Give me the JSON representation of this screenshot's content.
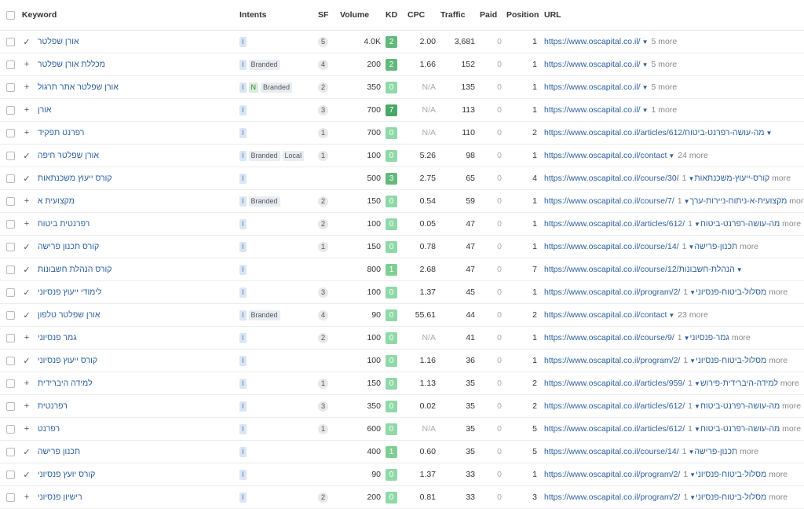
{
  "header": {
    "keyword": "Keyword",
    "intents": "Intents",
    "sf": "SF",
    "volume": "Volume",
    "kd": "KD",
    "cpc": "CPC",
    "traffic": "Traffic",
    "paid": "Paid",
    "position": "Position",
    "url": "URL"
  },
  "kd_colors": {
    "0": "#8fd9a8",
    "1": "#7fcf95",
    "2": "#62b97b",
    "3": "#62b97b",
    "7": "#4aa866"
  },
  "rows": [
    {
      "mark": "✓",
      "keyword": "אורן שפלטר",
      "intents": [
        "I"
      ],
      "sf": "5",
      "volume": "4.0K",
      "kd": "2",
      "cpc": "2.00",
      "traffic": "3,681",
      "paid": "0",
      "position": "1",
      "url": "https://www.oscapital.co.il/",
      "more": "5 more"
    },
    {
      "mark": "+",
      "keyword": "מכללת אורן שפלטר",
      "intents": [
        "I",
        "Branded"
      ],
      "sf": "4",
      "volume": "200",
      "kd": "2",
      "cpc": "1.66",
      "traffic": "152",
      "paid": "0",
      "position": "1",
      "url": "https://www.oscapital.co.il/",
      "more": "5 more"
    },
    {
      "mark": "+",
      "keyword": "אורן שפלטר אתר תרגול",
      "intents": [
        "I",
        "N",
        "Branded"
      ],
      "sf": "2",
      "volume": "350",
      "kd": "0",
      "cpc": "N/A",
      "traffic": "135",
      "paid": "0",
      "position": "1",
      "url": "https://www.oscapital.co.il/",
      "more": "5 more"
    },
    {
      "mark": "+",
      "keyword": "אורן",
      "intents": [
        "I"
      ],
      "sf": "3",
      "volume": "700",
      "kd": "7",
      "cpc": "N/A",
      "traffic": "113",
      "paid": "0",
      "position": "1",
      "url": "https://www.oscapital.co.il/",
      "more": "1 more"
    },
    {
      "mark": "+",
      "keyword": "רפרנט תפקיד",
      "intents": [
        "I"
      ],
      "sf": "1",
      "volume": "700",
      "kd": "0",
      "cpc": "N/A",
      "traffic": "110",
      "paid": "0",
      "position": "2",
      "url": "https://www.oscapital.co.il/articles/612/מה-עושה-רפרנט-ביטוח",
      "more": ""
    },
    {
      "mark": "✓",
      "keyword": "אורן שפלטר חיפה",
      "intents": [
        "I",
        "Branded",
        "Local"
      ],
      "sf": "1",
      "volume": "100",
      "kd": "0",
      "cpc": "5.26",
      "traffic": "98",
      "paid": "0",
      "position": "1",
      "url": "https://www.oscapital.co.il/contact",
      "more": "24 more"
    },
    {
      "mark": "✓",
      "keyword": "קורס ייעוץ משכנתאות",
      "intents": [
        "I"
      ],
      "sf": "",
      "volume": "500",
      "kd": "3",
      "cpc": "2.75",
      "traffic": "65",
      "paid": "0",
      "position": "4",
      "url": "https://www.oscapital.co.il/course/30/קורס-ייעוץ-משכנתאות",
      "more": "1 more"
    },
    {
      "mark": "+",
      "keyword": "מקצועית א",
      "intents": [
        "I",
        "Branded"
      ],
      "sf": "2",
      "volume": "150",
      "kd": "0",
      "cpc": "0.54",
      "traffic": "59",
      "paid": "0",
      "position": "1",
      "url": "https://www.oscapital.co.il/course/7/מקצועית-א-ניתוח-ניירות-ערך",
      "more": "1 more"
    },
    {
      "mark": "+",
      "keyword": "רפרנטית ביטוח",
      "intents": [
        "I"
      ],
      "sf": "2",
      "volume": "100",
      "kd": "0",
      "cpc": "0.05",
      "traffic": "47",
      "paid": "0",
      "position": "1",
      "url": "https://www.oscapital.co.il/articles/612/מה-עושה-רפרנט-ביטוח",
      "more": "1 more"
    },
    {
      "mark": "✓",
      "keyword": "קורס תכנון פרישה",
      "intents": [
        "I"
      ],
      "sf": "1",
      "volume": "150",
      "kd": "0",
      "cpc": "0.78",
      "traffic": "47",
      "paid": "0",
      "position": "1",
      "url": "https://www.oscapital.co.il/course/14/תכנון-פרישה",
      "more": "1 more"
    },
    {
      "mark": "✓",
      "keyword": "קורס הנהלת חשבונות",
      "intents": [
        "I"
      ],
      "sf": "",
      "volume": "800",
      "kd": "1",
      "cpc": "2.68",
      "traffic": "47",
      "paid": "0",
      "position": "7",
      "url": "https://www.oscapital.co.il/course/12/הנהלת-חשבונות",
      "more": ""
    },
    {
      "mark": "✓",
      "keyword": "לימודי ייעוץ פנסיוני",
      "intents": [
        "I"
      ],
      "sf": "3",
      "volume": "100",
      "kd": "0",
      "cpc": "1.37",
      "traffic": "45",
      "paid": "0",
      "position": "1",
      "url": "https://www.oscapital.co.il/program/2/מסלול-ביטוח-פנסיוני",
      "more": "1 more"
    },
    {
      "mark": "✓",
      "keyword": "אורן שפלטר טלפון",
      "intents": [
        "I",
        "Branded"
      ],
      "sf": "4",
      "volume": "90",
      "kd": "0",
      "cpc": "55.61",
      "traffic": "44",
      "paid": "0",
      "position": "2",
      "url": "https://www.oscapital.co.il/contact",
      "more": "23 more"
    },
    {
      "mark": "+",
      "keyword": "גמר פנסיוני",
      "intents": [
        "I"
      ],
      "sf": "2",
      "volume": "100",
      "kd": "0",
      "cpc": "N/A",
      "traffic": "41",
      "paid": "0",
      "position": "1",
      "url": "https://www.oscapital.co.il/course/9/גמר-פנסיוני",
      "more": "1 more"
    },
    {
      "mark": "✓",
      "keyword": "קורס ייעוץ פנסיוני",
      "intents": [
        "I"
      ],
      "sf": "",
      "volume": "100",
      "kd": "0",
      "cpc": "1.16",
      "traffic": "36",
      "paid": "0",
      "position": "1",
      "url": "https://www.oscapital.co.il/program/2/מסלול-ביטוח-פנסיוני",
      "more": "1 more"
    },
    {
      "mark": "+",
      "keyword": "למידה היברידית",
      "intents": [
        "I"
      ],
      "sf": "1",
      "volume": "150",
      "kd": "0",
      "cpc": "1.13",
      "traffic": "35",
      "paid": "0",
      "position": "2",
      "url": "https://www.oscapital.co.il/articles/959/למידה-היברידית-פירוש",
      "more": "1 more"
    },
    {
      "mark": "+",
      "keyword": "רפרנטית",
      "intents": [
        "I"
      ],
      "sf": "3",
      "volume": "350",
      "kd": "0",
      "cpc": "0.02",
      "traffic": "35",
      "paid": "0",
      "position": "2",
      "url": "https://www.oscapital.co.il/articles/612/מה-עושה-רפרנט-ביטוח",
      "more": "1 more"
    },
    {
      "mark": "+",
      "keyword": "רפרנט",
      "intents": [
        "I"
      ],
      "sf": "1",
      "volume": "600",
      "kd": "0",
      "cpc": "N/A",
      "traffic": "35",
      "paid": "0",
      "position": "5",
      "url": "https://www.oscapital.co.il/articles/612/מה-עושה-רפרנט-ביטוח",
      "more": "1 more"
    },
    {
      "mark": "✓",
      "keyword": "תכנון פרישה",
      "intents": [
        "I"
      ],
      "sf": "",
      "volume": "400",
      "kd": "1",
      "cpc": "0.60",
      "traffic": "35",
      "paid": "0",
      "position": "5",
      "url": "https://www.oscapital.co.il/course/14/תכנון-פרישה",
      "more": "1 more"
    },
    {
      "mark": "✓",
      "keyword": "קורס יועץ פנסיוני",
      "intents": [
        "I"
      ],
      "sf": "",
      "volume": "90",
      "kd": "0",
      "cpc": "1.37",
      "traffic": "33",
      "paid": "0",
      "position": "1",
      "url": "https://www.oscapital.co.il/program/2/מסלול-ביטוח-פנסיוני",
      "more": "1 more"
    },
    {
      "mark": "+",
      "keyword": "רישיון פנסיוני",
      "intents": [
        "I"
      ],
      "sf": "2",
      "volume": "200",
      "kd": "0",
      "cpc": "0.81",
      "traffic": "33",
      "paid": "0",
      "position": "3",
      "url": "https://www.oscapital.co.il/program/2/מסלול-ביטוח-פנסיוני",
      "more": "1 more"
    }
  ]
}
